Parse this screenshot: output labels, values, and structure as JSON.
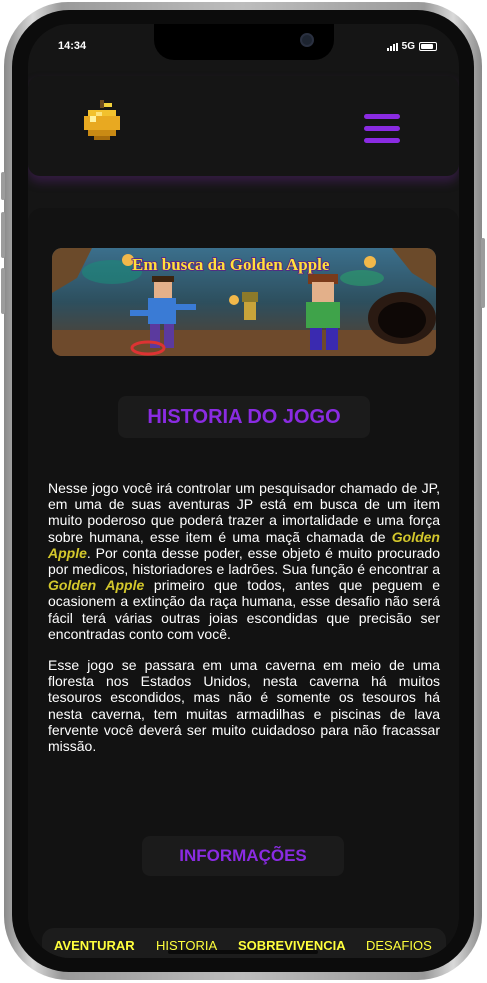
{
  "status": {
    "time": "14:34",
    "network": "5G"
  },
  "header": {
    "logo_icon": "golden-apple-icon",
    "menu_icon": "hamburger-menu-icon"
  },
  "banner": {
    "title": "Em busca da Golden Apple"
  },
  "sections": {
    "historia_title": "HISTORIA DO JOGO",
    "info_title": "INFORMAÇÕES"
  },
  "story": {
    "p1": [
      "Nesse jogo você irá controlar um pesquisador chamado de JP, em uma de suas aventuras JP está em busca de um item muito poderoso que poderá trazer a imortalidade e uma força sobre humana, esse item é uma maçã chamada de ",
      "Golden Apple",
      ". Por conta desse poder, esse objeto é muito procurado por medicos, historiadores e ladrões. Sua função é encontrar a ",
      "Golden Apple",
      " primeiro que todos, antes que peguem e ocasionem a extinção da raça humana, esse desafio não será fácil terá várias outras joias escondidas que precisão ser encontradas conto com você."
    ],
    "p2": "Esse jogo se passara em uma caverna em meio de uma floresta nos Estados Unidos, nesta caverna há muitos tesouros escondidos, mas não é somente os tesouros há nesta caverna, tem muitas armadilhas e piscinas de lava fervente você deverá ser muito cuidadoso para não fracassar missão."
  },
  "bottom_nav": [
    "AVENTURAR",
    "HISTORIA",
    "SOBREVIVENCIA",
    "DESAFIOS"
  ],
  "colors": {
    "accent": "#8a2be2",
    "gold": "#d3c72c",
    "nav": "#ffff3c",
    "background": "#151515"
  }
}
